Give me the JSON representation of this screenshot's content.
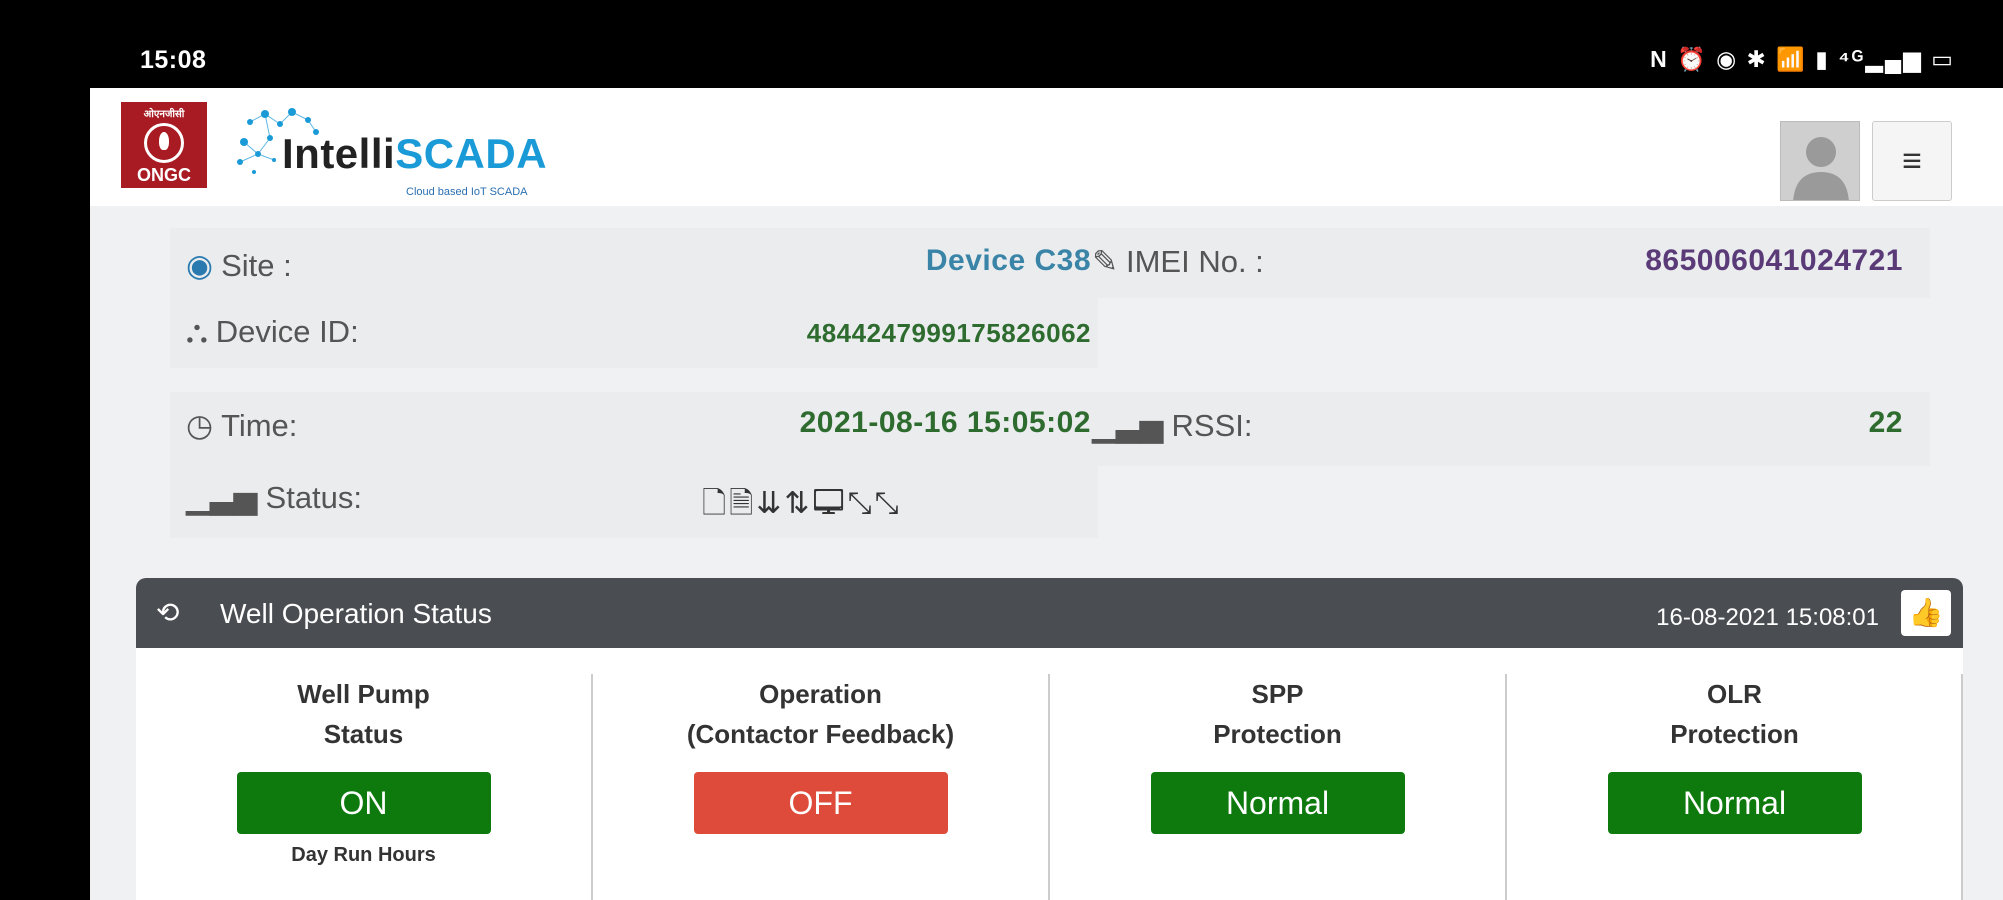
{
  "status_bar": {
    "time": "15:08",
    "icons_text": "N ⏰ ◉ ✱ 📶 ▮ ⁴ᴳ▂▄▆ ▭"
  },
  "header": {
    "ongc_top": "ओएनजीसी",
    "ongc_word": "ONGC",
    "brand_prefix": "Intelli",
    "brand_suffix": "SCADA",
    "brand_tagline": "Cloud based IoT SCADA",
    "menu_icon": "≡"
  },
  "device": {
    "site_label": "Site :",
    "site_value": "Device C38",
    "device_id_label": "Device ID:",
    "device_id_value": "4844247999175826062",
    "imei_label": "IMEI No. :",
    "imei_value": "865006041024721",
    "time_label": "Time:",
    "time_value": "2021-08-16 15:05:02",
    "rssi_label": "RSSI:",
    "rssi_value": "22",
    "status_label": "Status:",
    "status_icons": "🗋🗎⇊⇅🖵⤡⤡"
  },
  "panel": {
    "title": "Well Operation Status",
    "timestamp": "16-08-2021 15:08:01",
    "columns": [
      {
        "title": "Well Pump\nStatus",
        "value": "ON",
        "state": "on",
        "sub": "Day Run Hours"
      },
      {
        "title": "Operation\n(Contactor Feedback)",
        "value": "OFF",
        "state": "off",
        "sub": ""
      },
      {
        "title": "SPP\nProtection",
        "value": "Normal",
        "state": "on",
        "sub": ""
      },
      {
        "title": "OLR\nProtection",
        "value": "Normal",
        "state": "on",
        "sub": ""
      }
    ]
  },
  "colors": {
    "on": "#0e7a0e",
    "off": "#de4b3b",
    "site_value": "#3a84a8",
    "green_value": "#2e6b2e",
    "imei_value": "#5b3a78",
    "panel_head": "#4a4d51"
  }
}
